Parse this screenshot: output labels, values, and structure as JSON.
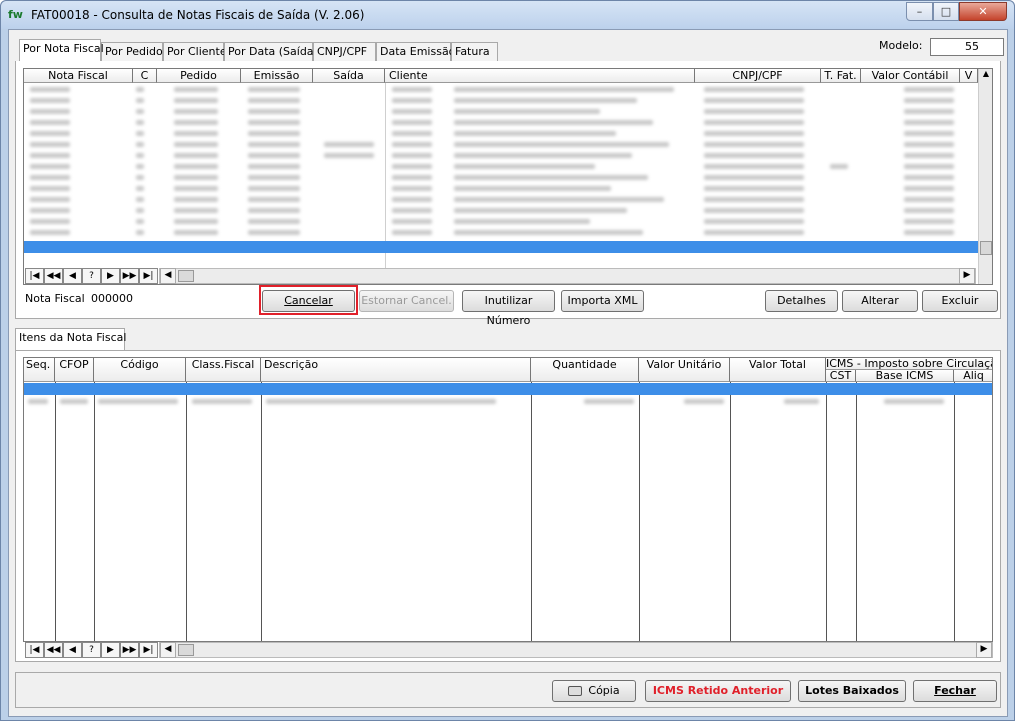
{
  "window": {
    "title": "FAT00018 - Consulta de Notas Fiscais de Saída (V. 2.06)",
    "logo": "fw",
    "min": "–",
    "max": "□",
    "close": "✕"
  },
  "tabs": [
    {
      "label": "Por Nota Fiscal"
    },
    {
      "label": "Por Pedido"
    },
    {
      "label": "Por Cliente"
    },
    {
      "label": "Por Data (Saída)"
    },
    {
      "label": "CNPJ/CPF"
    },
    {
      "label": "Data Emissão"
    },
    {
      "label": "Fatura"
    }
  ],
  "modelo": {
    "label": "Modelo:",
    "value": "55"
  },
  "notas_grid": {
    "columns": [
      "Nota Fiscal",
      "C",
      "Pedido",
      "Emissão",
      "Saída",
      "Cliente",
      "CNPJ/CPF",
      "T. Fat.",
      "Valor Contábil",
      "V"
    ]
  },
  "nav": [
    "|◀",
    "◀◀",
    "◀",
    "?",
    "▶",
    "▶▶",
    "▶|"
  ],
  "nota_fiscal": {
    "label": "Nota Fiscal",
    "value": "000000"
  },
  "actions": {
    "cancelar": "Cancelar",
    "estornar": "Estornar Cancel.",
    "inutilizar": "Inutilizar Número",
    "importa_xml": "Importa XML",
    "detalhes": "Detalhes",
    "alterar": "Alterar",
    "excluir": "Excluir"
  },
  "itens_tab": {
    "label": "Itens da Nota Fiscal"
  },
  "itens_grid": {
    "columns": [
      "Seq.",
      "CFOP",
      "Código",
      "Class.Fiscal",
      "Descrição",
      "Quantidade",
      "Valor Unitário",
      "Valor Total"
    ],
    "icms_group": "ICMS - Imposto sobre Circulação",
    "icms_sub": [
      "CST",
      "Base ICMS",
      "Aliq"
    ]
  },
  "footer": {
    "copia": "Cópia",
    "icms_retido": "ICMS Retido Anterior",
    "lotes": "Lotes Baixados",
    "fechar": "Fechar"
  },
  "colors": {
    "highlight": "#e0202a",
    "selection": "#3d8ee8",
    "icms_text": "#e0202a"
  }
}
